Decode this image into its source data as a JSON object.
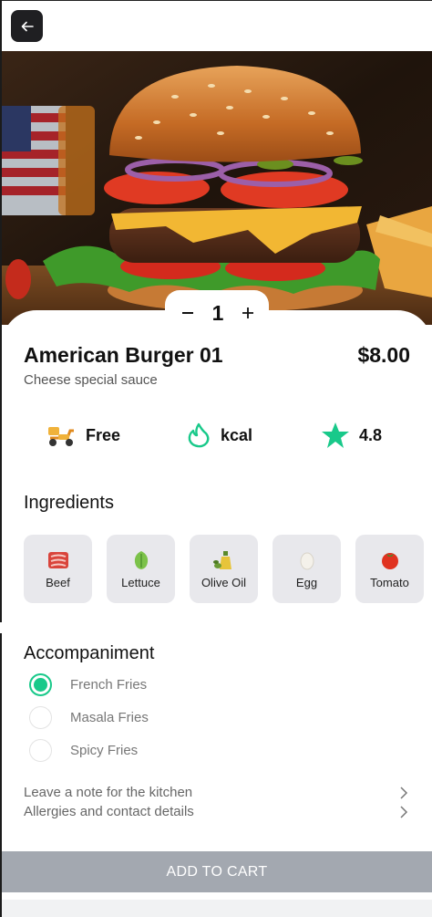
{
  "product": {
    "title": "American Burger 01",
    "subtitle": "Cheese special sauce",
    "price": "$8.00",
    "quantity": "1"
  },
  "info": {
    "delivery": {
      "label": "Free",
      "icon": "scooter-icon"
    },
    "calories": {
      "label": "kcal",
      "icon": "flame-icon"
    },
    "rating": {
      "label": "4.8",
      "icon": "star-icon"
    }
  },
  "ingredients": {
    "title": "Ingredients",
    "items": [
      {
        "label": "Beef",
        "icon": "meat-icon"
      },
      {
        "label": "Lettuce",
        "icon": "lettuce-icon"
      },
      {
        "label": "Olive Oil",
        "icon": "olive-oil-icon"
      },
      {
        "label": "Egg",
        "icon": "egg-icon"
      },
      {
        "label": "Tomato",
        "icon": "tomato-icon"
      }
    ]
  },
  "accompaniment": {
    "title": "Accompaniment",
    "options": [
      {
        "label": "French Fries",
        "selected": true
      },
      {
        "label": "Masala Fries",
        "selected": false
      },
      {
        "label": "Spicy Fries",
        "selected": false
      }
    ]
  },
  "links": {
    "note": "Leave a note for the kitchen",
    "allergies": "Allergies and contact details"
  },
  "cart_button": "ADD TO CART",
  "colors": {
    "accent": "#19c98a",
    "button_bg": "#a3a8b0",
    "tile_bg": "#e8e8ec",
    "back_btn": "#1f1f22"
  }
}
